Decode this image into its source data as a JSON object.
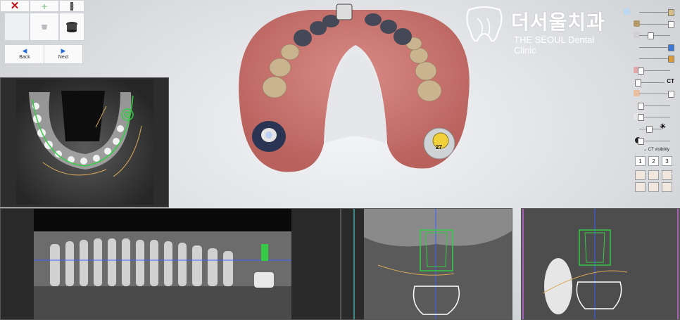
{
  "toolbar": {
    "back_label": "Back",
    "next_label": "Next",
    "delete_icon": "close-x-icon",
    "add_icon": "plus-icon",
    "implant_icon": "implant-icon",
    "crown_icon": "crown-icon",
    "abutment_icon": "abutment-icon"
  },
  "logo": {
    "korean": "더서울치과",
    "english": "THE SEOUL Dental Clinic"
  },
  "model": {
    "tooth_tag": "27"
  },
  "controls": {
    "ct_label": "CT",
    "ct_visibility_label": "CT visibility",
    "view_buttons": [
      "1",
      "2",
      "3"
    ]
  },
  "colors": {
    "implant_green": "#33cc44",
    "nerve_orange": "#d9a95a",
    "axis_blue": "#3d5cff",
    "axis_magenta": "#c46bd9",
    "axis_cyan": "#4de0e0",
    "accent_blue": "#2a6fd6"
  }
}
